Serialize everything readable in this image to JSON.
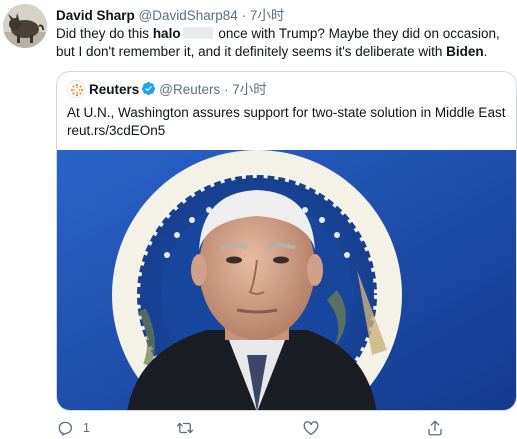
{
  "tweet": {
    "author": {
      "display_name": "David Sharp",
      "handle": "@DavidSharp84",
      "separator": "·",
      "time": "7小时"
    },
    "text": {
      "part1": "Did they do this ",
      "bold1": "halo",
      "part2": " once with Trump? Maybe they did on occasion, but I don't remember it, and it definitely seems it's deliberate with ",
      "bold2": "Biden",
      "part3": "."
    },
    "quote": {
      "display_name": "Reuters",
      "handle": "@Reuters",
      "separator": "·",
      "time": "7小时",
      "text": "At U.N., Washington assures support for two-state solution in Middle East",
      "link": "reut.rs/3cdEOn5"
    },
    "actions": {
      "reply_count": "1",
      "retweet_count": "",
      "like_count": "",
      "share_count": ""
    }
  },
  "colors": {
    "text": "#0f1419",
    "secondary": "#5b7083",
    "border": "#cfd9de",
    "verified": "#1da1f2",
    "seal_blue": "#1f4fa8"
  },
  "icons": [
    "avatar-image",
    "reuters-logo-icon",
    "verified-badge-icon",
    "reply-icon",
    "retweet-icon",
    "like-icon",
    "share-icon"
  ]
}
